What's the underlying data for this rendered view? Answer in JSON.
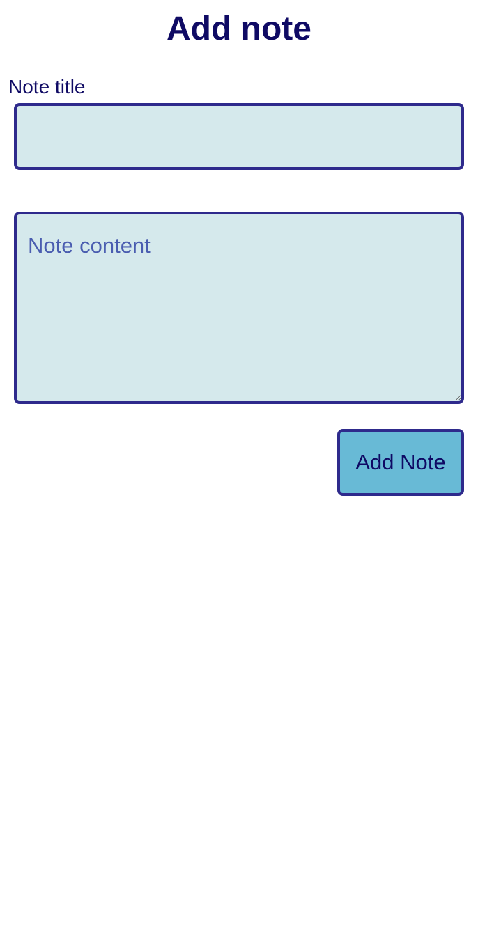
{
  "page": {
    "title": "Add note"
  },
  "form": {
    "title_label": "Note title",
    "title_value": "",
    "content_placeholder": "Note content",
    "content_value": "",
    "submit_label": "Add Note"
  },
  "colors": {
    "text_primary": "#0f0a64",
    "border": "#2e2a8c",
    "field_background": "#d5e9ec",
    "button_background": "#68bad6",
    "placeholder": "#4a5db0"
  }
}
